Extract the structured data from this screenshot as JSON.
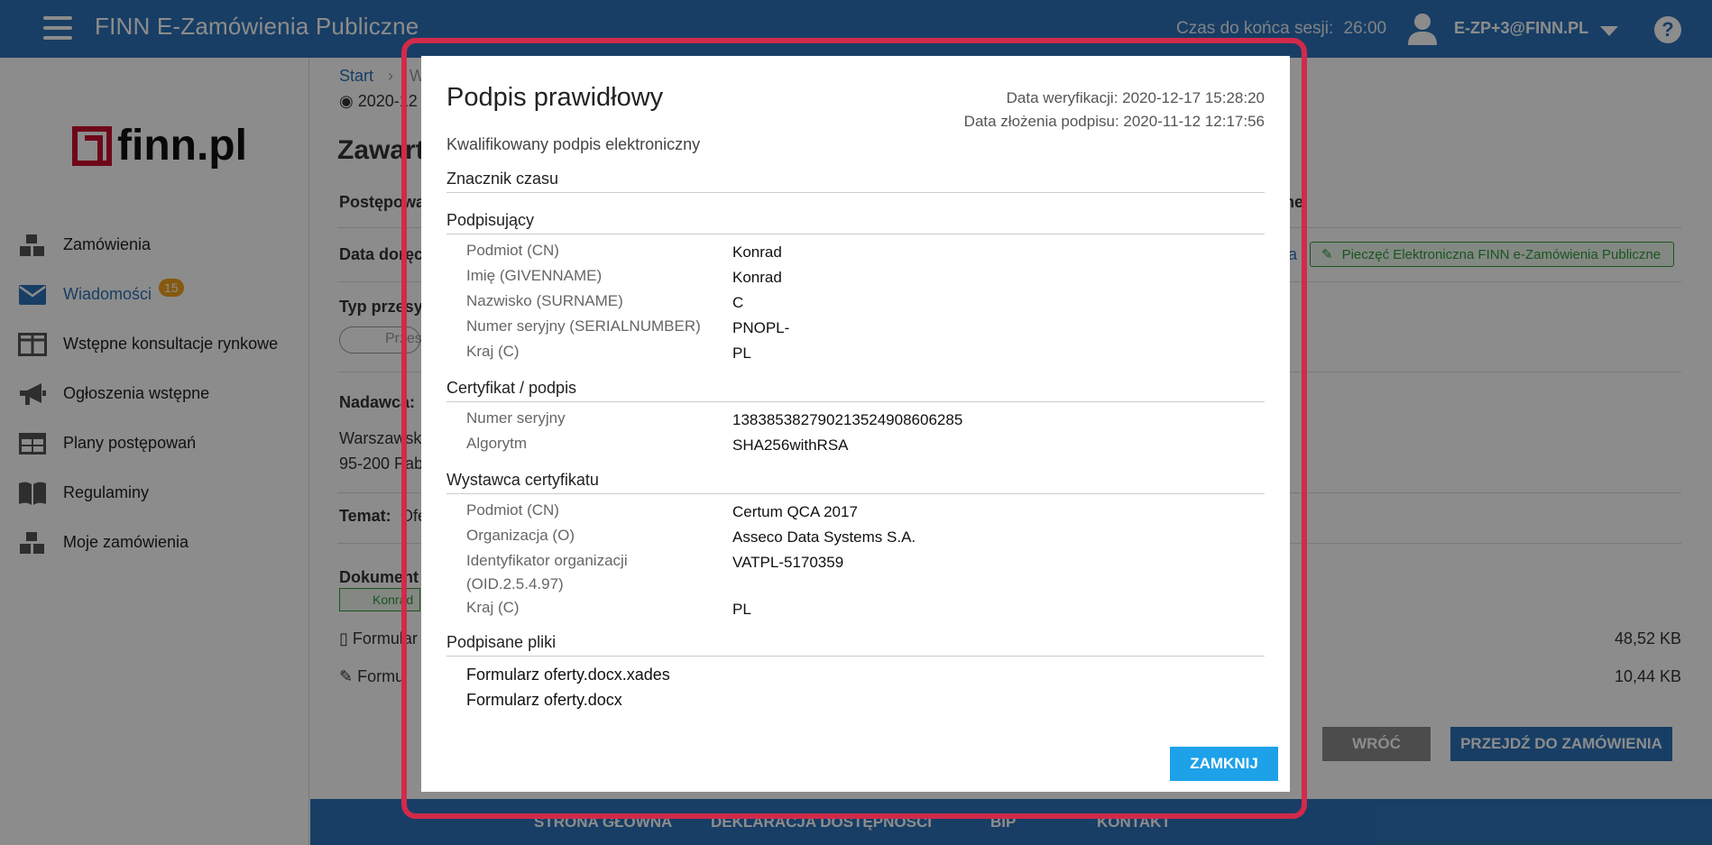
{
  "header": {
    "app_title": "FINN E-Zamówienia Publiczne",
    "session_label": "Czas do końca sesji:",
    "session_time": "26:00",
    "user": "E-ZP+3@FINN.PL"
  },
  "sidebar": {
    "logo": "finn.pl",
    "items": [
      {
        "label": "Zamówienia"
      },
      {
        "label": "Wiadomości",
        "badge": "15"
      },
      {
        "label": "Wstępne konsultacje rynkowe"
      },
      {
        "label": "Ogłoszenia wstępne"
      },
      {
        "label": "Plany postępowań"
      },
      {
        "label": "Regulaminy"
      },
      {
        "label": "Moje zamówienia"
      }
    ]
  },
  "background": {
    "breadcrumb_start": "Start",
    "breadcrumb_next": "W",
    "date_partial": "2020-12",
    "heading_partial": "Zawart",
    "postepow": "Postępowa",
    "data_dor": "Data doręc",
    "typ_prz": "Typ przesy",
    "prz_chip": "Przes",
    "nadawca": "Nadawca:",
    "addr1": "Warszawsk",
    "addr2": "95-200 Pab",
    "temat": "Temat:",
    "temat_val": "Ofe",
    "dokumenty": "Dokument",
    "konrad_chip": "Konrad",
    "formular1": "Formular",
    "formular2": "Formu",
    "size1": "48,52 KB",
    "size2": "10,44 KB",
    "ne_partial": "ne",
    "ia_partial": "ia",
    "seal": "Pieczęć Elektroniczna FINN e-Zamówienia Publiczne",
    "btn_back": "WRÓĆ",
    "btn_go": "PRZEJDŹ DO ZAMÓWIENIA",
    "footer": [
      "STRONA GŁÓWNA",
      "DEKLARACJA DOSTĘPNOŚCI",
      "BIP",
      "KONTAKT"
    ]
  },
  "modal": {
    "title": "Podpis prawidłowy",
    "verify_date": "Data weryfikacji: 2020-12-17 15:28:20",
    "sign_date": "Data złożenia podpisu: 2020-11-12 12:17:56",
    "subtitle": "Kwalifikowany podpis elektroniczny",
    "timestamp_section": "Znacznik czasu",
    "signer_section": "Podpisujący",
    "signer": [
      {
        "label": "Podmiot (CN)",
        "value": "Konrad"
      },
      {
        "label": "Imię (GIVENNAME)",
        "value": "Konrad"
      },
      {
        "label": "Nazwisko (SURNAME)",
        "value": "C"
      },
      {
        "label": "Numer seryjny (SERIALNUMBER)",
        "value": "PNOPL-"
      },
      {
        "label": "Kraj (C)",
        "value": "PL"
      }
    ],
    "cert_section": "Certyfikat / podpis",
    "cert": [
      {
        "label": "Numer seryjny",
        "value": "138385382790213524908606285"
      },
      {
        "label": "Algorytm",
        "value": "SHA256withRSA"
      }
    ],
    "issuer_section": "Wystawca certyfikatu",
    "issuer": [
      {
        "label": "Podmiot (CN)",
        "value": "Certum QCA 2017"
      },
      {
        "label": "Organizacja (O)",
        "value": "Asseco Data Systems S.A."
      },
      {
        "label": "Identyfikator organizacji",
        "label2": "(OID.2.5.4.97)",
        "value": "VATPL-5170359"
      },
      {
        "label": "Kraj (C)",
        "value": "PL"
      }
    ],
    "files_section": "Podpisane pliki",
    "files": [
      "Formularz oferty.docx.xades",
      "Formularz oferty.docx"
    ],
    "close_button": "ZAMKNIJ"
  }
}
